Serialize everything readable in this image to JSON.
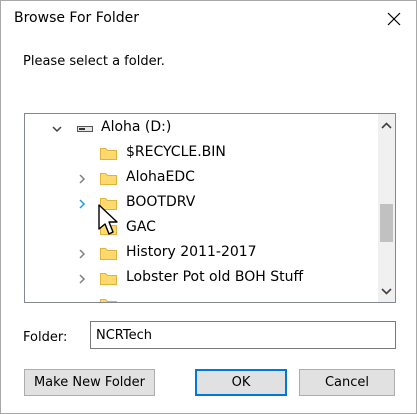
{
  "window": {
    "title": "Browse For Folder",
    "close_glyph": "✕"
  },
  "prompt": "Please select a folder.",
  "tree": {
    "drive": {
      "label": "Aloha (D:)",
      "expanded": true
    },
    "items": [
      {
        "label": "$RECYCLE.BIN",
        "has_children": false
      },
      {
        "label": "AlohaEDC",
        "has_children": true
      },
      {
        "label": "BOOTDRV",
        "has_children": true,
        "hovered": true
      },
      {
        "label": "GAC",
        "has_children": false
      },
      {
        "label": "History 2011-2017",
        "has_children": true
      },
      {
        "label": "Lobster Pot old BOH Stuff",
        "has_children": true
      }
    ]
  },
  "folder_field": {
    "label": "Folder:",
    "value": "NCRTech"
  },
  "buttons": {
    "make_new_folder": "Make New Folder",
    "ok": "OK",
    "cancel": "Cancel"
  },
  "colors": {
    "accent": "#0078d7",
    "folder_fill": "#ffd96b",
    "folder_edge": "#e2b33c"
  }
}
